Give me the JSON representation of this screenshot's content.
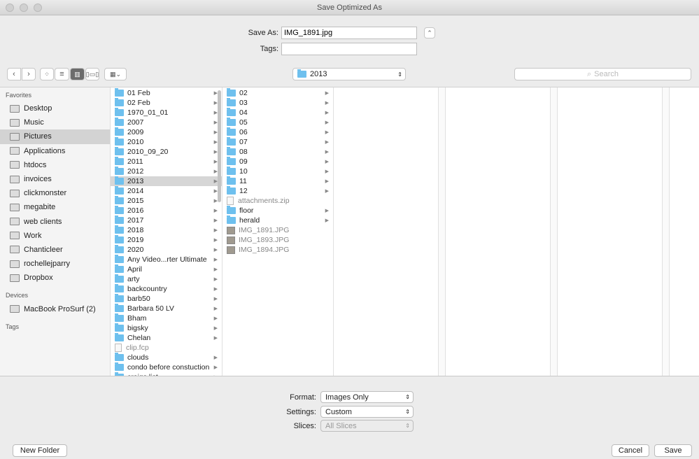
{
  "window": {
    "title": "Save Optimized As"
  },
  "save": {
    "save_as_label": "Save As:",
    "filename": "IMG_1891.jpg",
    "tags_label": "Tags:",
    "tags_value": ""
  },
  "toolbar": {
    "location": "2013",
    "search_placeholder": "Search",
    "view_modes": [
      "icon",
      "list",
      "column",
      "cover-flow"
    ],
    "active_view": "column"
  },
  "sidebar": {
    "favorites_header": "Favorites",
    "favorites": [
      {
        "label": "Desktop",
        "icon": "desktop-icon"
      },
      {
        "label": "Music",
        "icon": "music-icon"
      },
      {
        "label": "Pictures",
        "icon": "camera-icon",
        "selected": true
      },
      {
        "label": "Applications",
        "icon": "applications-icon"
      },
      {
        "label": "htdocs",
        "icon": "folder-icon"
      },
      {
        "label": "invoices",
        "icon": "folder-icon"
      },
      {
        "label": "clickmonster",
        "icon": "folder-icon"
      },
      {
        "label": "megabite",
        "icon": "folder-icon"
      },
      {
        "label": "web clients",
        "icon": "folder-icon"
      },
      {
        "label": "Work",
        "icon": "folder-icon"
      },
      {
        "label": "Chanticleer",
        "icon": "folder-icon"
      },
      {
        "label": "rochellejparry",
        "icon": "home-icon"
      },
      {
        "label": "Dropbox",
        "icon": "folder-icon"
      }
    ],
    "devices_header": "Devices",
    "devices": [
      {
        "label": "MacBook ProSurf (2)",
        "icon": "laptop-icon"
      }
    ],
    "tags_header": "Tags"
  },
  "column1": [
    "01 Feb",
    "02 Feb",
    "1970_01_01",
    "2007",
    "2009",
    "2010",
    "2010_09_20",
    "2011",
    "2012",
    "2013",
    "2014",
    "2015",
    "2016",
    "2017",
    "2018",
    "2019",
    "2020",
    "Any Video...rter Ultimate",
    "April",
    "arty",
    "backcountry",
    "barb50",
    "Barbara 50 LV",
    "Bham",
    "bigsky",
    "Chelan",
    "clip.fcp",
    "clouds",
    "condo before constuction",
    "craigs list"
  ],
  "column1_selected": "2013",
  "column2": [
    {
      "name": "02",
      "type": "folder"
    },
    {
      "name": "03",
      "type": "folder"
    },
    {
      "name": "04",
      "type": "folder"
    },
    {
      "name": "05",
      "type": "folder"
    },
    {
      "name": "06",
      "type": "folder"
    },
    {
      "name": "07",
      "type": "folder"
    },
    {
      "name": "08",
      "type": "folder"
    },
    {
      "name": "09",
      "type": "folder"
    },
    {
      "name": "10",
      "type": "folder"
    },
    {
      "name": "11",
      "type": "folder"
    },
    {
      "name": "12",
      "type": "folder"
    },
    {
      "name": "attachments.zip",
      "type": "file"
    },
    {
      "name": "floor",
      "type": "folder"
    },
    {
      "name": "herald",
      "type": "folder"
    },
    {
      "name": "IMG_1891.JPG",
      "type": "image"
    },
    {
      "name": "IMG_1893.JPG",
      "type": "image"
    },
    {
      "name": "IMG_1894.JPG",
      "type": "image"
    }
  ],
  "options": {
    "format_label": "Format:",
    "format_value": "Images Only",
    "settings_label": "Settings:",
    "settings_value": "Custom",
    "slices_label": "Slices:",
    "slices_value": "All Slices"
  },
  "buttons": {
    "new_folder": "New Folder",
    "cancel": "Cancel",
    "save": "Save"
  }
}
